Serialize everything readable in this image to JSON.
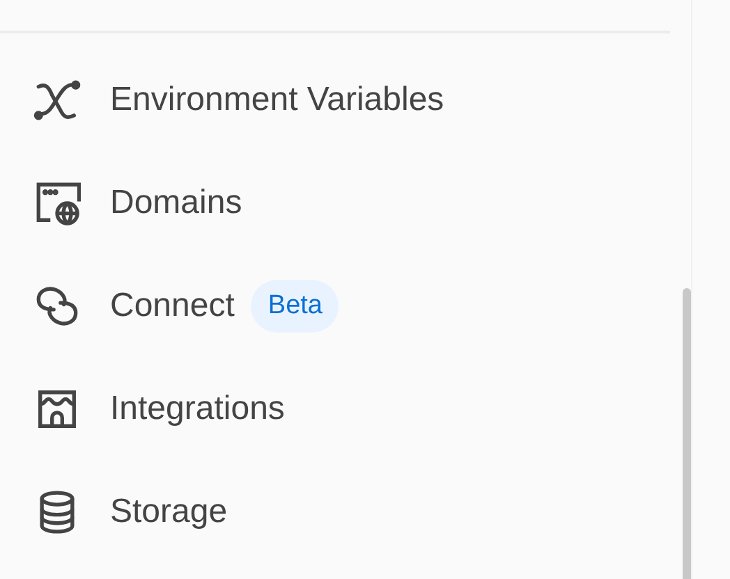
{
  "nav_items": [
    {
      "label": "Environment Variables"
    },
    {
      "label": "Domains"
    },
    {
      "label": "Connect",
      "badge": "Beta"
    },
    {
      "label": "Integrations"
    },
    {
      "label": "Storage"
    }
  ]
}
